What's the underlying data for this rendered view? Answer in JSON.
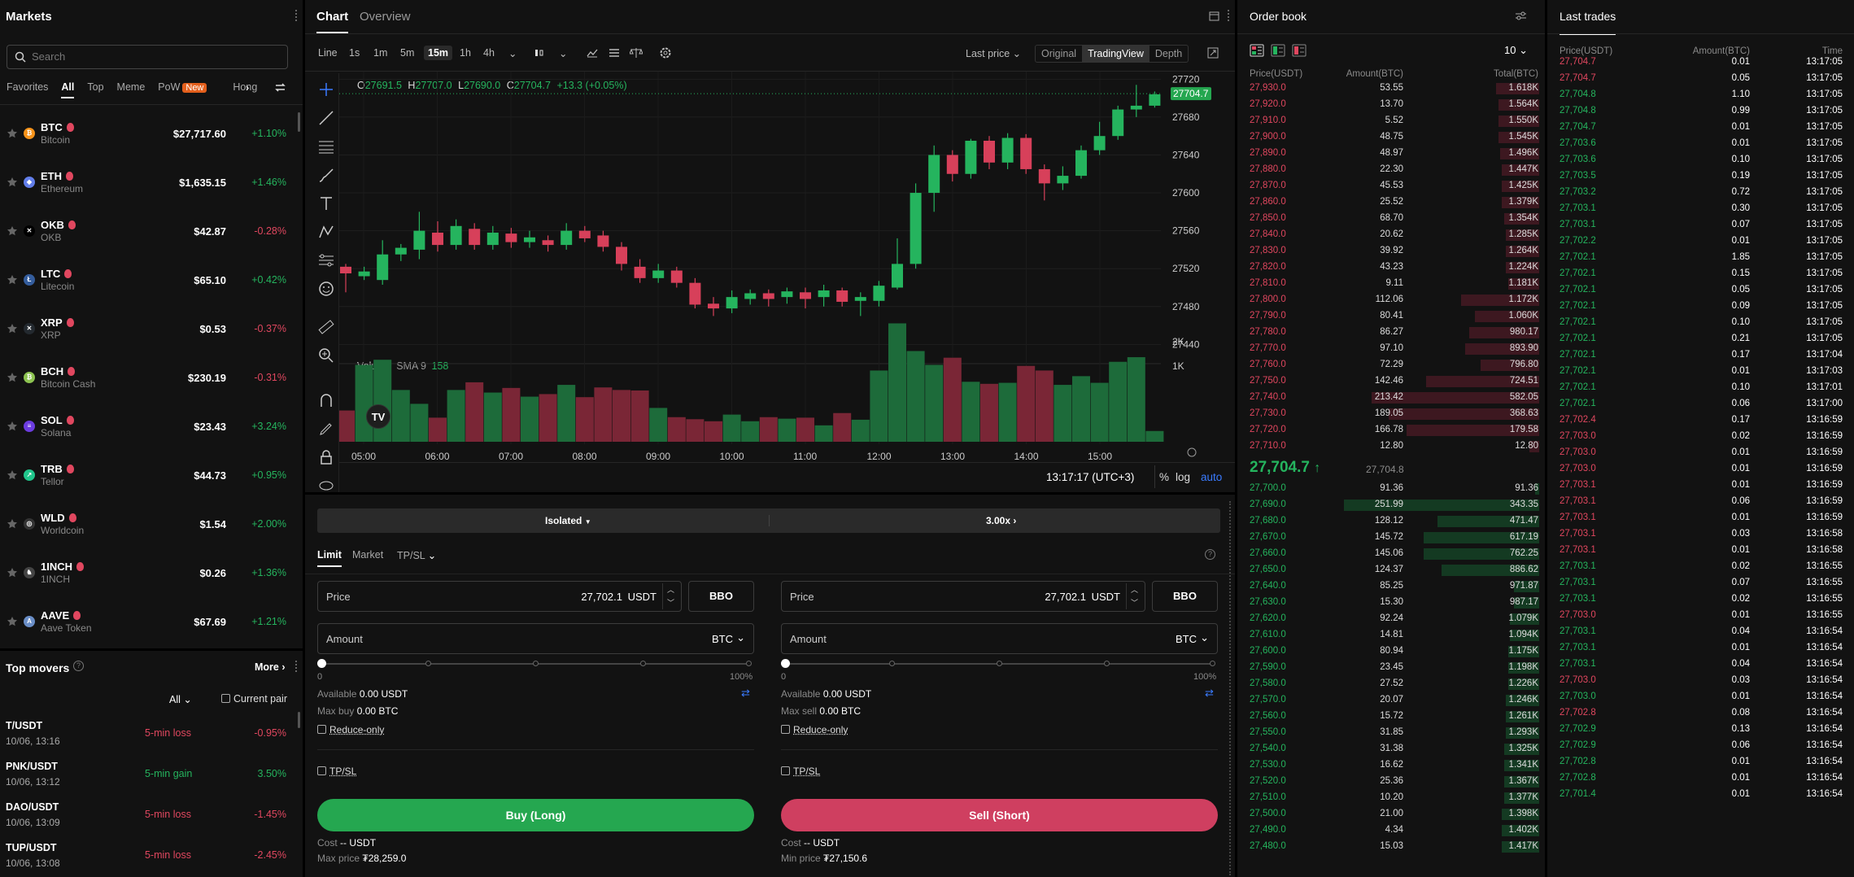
{
  "markets": {
    "title": "Markets",
    "search_placeholder": "Search",
    "tabs": [
      "Favorites",
      "All",
      "Top",
      "Meme",
      "PoW",
      "Hong"
    ],
    "new_badge": "New",
    "coins": [
      {
        "sym": "BTC",
        "name": "Bitcoin",
        "price": "$27,717.60",
        "change": "+1.10%",
        "up": true,
        "color": "#f7931a",
        "glyph": "₿"
      },
      {
        "sym": "ETH",
        "name": "Ethereum",
        "price": "$1,635.15",
        "change": "+1.46%",
        "up": true,
        "color": "#627eea",
        "glyph": "◆"
      },
      {
        "sym": "OKB",
        "name": "OKB",
        "price": "$42.87",
        "change": "-0.28%",
        "up": false,
        "color": "#000000",
        "glyph": "✕"
      },
      {
        "sym": "LTC",
        "name": "Litecoin",
        "price": "$65.10",
        "change": "+0.42%",
        "up": true,
        "color": "#345d9d",
        "glyph": "Ł"
      },
      {
        "sym": "XRP",
        "name": "XRP",
        "price": "$0.53",
        "change": "-0.37%",
        "up": false,
        "color": "#23292f",
        "glyph": "✕"
      },
      {
        "sym": "BCH",
        "name": "Bitcoin Cash",
        "price": "$230.19",
        "change": "-0.31%",
        "up": false,
        "color": "#8dc351",
        "glyph": "₿"
      },
      {
        "sym": "SOL",
        "name": "Solana",
        "price": "$23.43",
        "change": "+3.24%",
        "up": true,
        "color": "#6c3ce0",
        "glyph": "≡"
      },
      {
        "sym": "TRB",
        "name": "Tellor",
        "price": "$44.73",
        "change": "+0.95%",
        "up": true,
        "color": "#20c58b",
        "glyph": "↗"
      },
      {
        "sym": "WLD",
        "name": "Worldcoin",
        "price": "$1.54",
        "change": "+2.00%",
        "up": true,
        "color": "#333333",
        "glyph": "◎"
      },
      {
        "sym": "1INCH",
        "name": "1INCH",
        "price": "$0.26",
        "change": "+1.36%",
        "up": true,
        "color": "#444444",
        "glyph": "♞"
      },
      {
        "sym": "AAVE",
        "name": "Aave Token",
        "price": "$67.69",
        "change": "+1.21%",
        "up": true,
        "color": "#6a8ec7",
        "glyph": "A"
      }
    ]
  },
  "movers": {
    "title": "Top movers",
    "more": "More",
    "filter": "All",
    "current_pair": "Current pair",
    "items": [
      {
        "pair": "T/USDT",
        "date": "10/06, 13:16",
        "type": "5-min loss",
        "value": "-0.95%",
        "up": false
      },
      {
        "pair": "PNK/USDT",
        "date": "10/06, 13:12",
        "type": "5-min gain",
        "value": "3.50%",
        "up": true
      },
      {
        "pair": "DAO/USDT",
        "date": "10/06, 13:09",
        "type": "5-min loss",
        "value": "-1.45%",
        "up": false
      },
      {
        "pair": "TUP/USDT",
        "date": "10/06, 13:08",
        "type": "5-min loss",
        "value": "-2.45%",
        "up": false
      }
    ]
  },
  "chart": {
    "tabs": [
      "Chart",
      "Overview"
    ],
    "intervals": [
      "Line",
      "1s",
      "1m",
      "5m",
      "15m",
      "1h",
      "4h"
    ],
    "active_interval": "15m",
    "price_type": "Last price",
    "views": [
      "Original",
      "TradingView",
      "Depth"
    ],
    "active_view": "TradingView",
    "ohlc": {
      "o_label": "O",
      "o": "27691.5",
      "h_label": "H",
      "h": "27707.0",
      "l_label": "L",
      "l": "27690.0",
      "c_label": "C",
      "c": "27704.7",
      "chg": "+13.3 (+0.05%)"
    },
    "volume_label": "Volume",
    "sma_label": "SMA 9",
    "sma_value": "158",
    "time": "13:17:17 (UTC+3)",
    "pct": "%",
    "log": "log",
    "auto": "auto",
    "last_price_tag": "27704.7",
    "chart_data": {
      "type": "candlestick",
      "x_ticks": [
        "05:00",
        "06:00",
        "07:00",
        "08:00",
        "09:00",
        "10:00",
        "11:00",
        "12:00",
        "13:00",
        "14:00",
        "15:00"
      ],
      "y_ticks": [
        27720,
        27680,
        27640,
        27600,
        27560,
        27520,
        27480,
        27440
      ],
      "vol_ticks": [
        "2K",
        "1K"
      ],
      "ylim": [
        27430,
        27728
      ],
      "candles": [
        [
          27522,
          27515,
          27495,
          27525
        ],
        [
          27512,
          27517,
          27508,
          27522
        ],
        [
          27508,
          27535,
          27503,
          27550
        ],
        [
          27535,
          27542,
          27528,
          27546
        ],
        [
          27540,
          27560,
          27530,
          27580
        ],
        [
          27558,
          27545,
          27538,
          27570
        ],
        [
          27545,
          27565,
          27540,
          27572
        ],
        [
          27562,
          27545,
          27540,
          27568
        ],
        [
          27545,
          27558,
          27540,
          27565
        ],
        [
          27557,
          27548,
          27542,
          27563
        ],
        [
          27548,
          27553,
          27542,
          27560
        ],
        [
          27550,
          27545,
          27538,
          27555
        ],
        [
          27545,
          27560,
          27540,
          27568
        ],
        [
          27560,
          27552,
          27548,
          27565
        ],
        [
          27555,
          27543,
          27538,
          27560
        ],
        [
          27543,
          27525,
          27518,
          27548
        ],
        [
          27522,
          27510,
          27505,
          27530
        ],
        [
          27510,
          27518,
          27505,
          27525
        ],
        [
          27518,
          27505,
          27500,
          27522
        ],
        [
          27505,
          27482,
          27478,
          27510
        ],
        [
          27483,
          27478,
          27470,
          27490
        ],
        [
          27478,
          27490,
          27473,
          27497
        ],
        [
          27488,
          27494,
          27482,
          27498
        ],
        [
          27494,
          27488,
          27480,
          27498
        ],
        [
          27490,
          27496,
          27483,
          27500
        ],
        [
          27495,
          27488,
          27478,
          27500
        ],
        [
          27490,
          27497,
          27480,
          27503
        ],
        [
          27497,
          27485,
          27480,
          27500
        ],
        [
          27486,
          27490,
          27470,
          27495
        ],
        [
          27486,
          27502,
          27480,
          27507
        ],
        [
          27500,
          27525,
          27498,
          27552
        ],
        [
          27525,
          27600,
          27520,
          27610
        ],
        [
          27600,
          27640,
          27580,
          27650
        ],
        [
          27640,
          27620,
          27612,
          27645
        ],
        [
          27620,
          27655,
          27615,
          27657
        ],
        [
          27655,
          27632,
          27625,
          27660
        ],
        [
          27632,
          27658,
          27625,
          27663
        ],
        [
          27658,
          27625,
          27620,
          27662
        ],
        [
          27625,
          27610,
          27592,
          27630
        ],
        [
          27610,
          27618,
          27603,
          27628
        ],
        [
          27618,
          27645,
          27615,
          27650
        ],
        [
          27645,
          27660,
          27640,
          27675
        ],
        [
          27660,
          27688,
          27656,
          27692
        ],
        [
          27688,
          27692,
          27680,
          27714
        ],
        [
          27692,
          27704,
          27690,
          27707
        ]
      ],
      "volumes": [
        610,
        1500,
        1600,
        1010,
        740,
        470,
        1010,
        1160,
        960,
        1050,
        880,
        930,
        1110,
        870,
        1060,
        1010,
        1000,
        660,
        480,
        440,
        400,
        530,
        400,
        480,
        450,
        470,
        320,
        560,
        430,
        1390,
        2310,
        1770,
        1500,
        1640,
        1170,
        1130,
        1150,
        1480,
        1390,
        1110,
        1280,
        1150,
        1560,
        1650,
        210
      ]
    }
  },
  "trade": {
    "margin_mode": "Isolated",
    "leverage": "3.00x",
    "tabs": [
      "Limit",
      "Market",
      "TP/SL"
    ],
    "price_label": "Price",
    "amount_label": "Amount",
    "unit": "USDT",
    "coin": "BTC",
    "bbo": "BBO",
    "buy": {
      "price": "27,702.1",
      "available_label": "Available",
      "available": "0.00 USDT",
      "max_label": "Max buy",
      "max": "0.00 BTC",
      "btn": "Buy (Long)",
      "cost_label": "Cost",
      "cost": "-- USDT",
      "maxp_label": "Max price",
      "maxp": "₮28,259.0"
    },
    "sell": {
      "price": "27,702.1",
      "available_label": "Available",
      "available": "0.00 USDT",
      "max_label": "Max sell",
      "max": "0.00 BTC",
      "btn": "Sell (Short)",
      "cost_label": "Cost",
      "cost": "-- USDT",
      "maxp_label": "Min price",
      "maxp": "₮27,150.6"
    },
    "slider_min": "0",
    "slider_max": "100%",
    "reduce_only": "Reduce-only",
    "tpsl": "TP/SL"
  },
  "orderbook": {
    "title": "Order book",
    "depth": "10",
    "headers": [
      "Price(USDT)",
      "Amount(BTC)",
      "Total(BTC)"
    ],
    "mid_price": "27,704.7",
    "mid_index": "27,704.8",
    "asks": [
      [
        "27,930.0",
        "53.55",
        "1.618K",
        0.22
      ],
      [
        "27,920.0",
        "13.70",
        "1.564K",
        0.21
      ],
      [
        "27,910.0",
        "5.52",
        "1.550K",
        0.21
      ],
      [
        "27,900.0",
        "48.75",
        "1.545K",
        0.21
      ],
      [
        "27,890.0",
        "48.97",
        "1.496K",
        0.2
      ],
      [
        "27,880.0",
        "22.30",
        "1.447K",
        0.19
      ],
      [
        "27,870.0",
        "45.53",
        "1.425K",
        0.19
      ],
      [
        "27,860.0",
        "25.52",
        "1.379K",
        0.19
      ],
      [
        "27,850.0",
        "68.70",
        "1.354K",
        0.18
      ],
      [
        "27,840.0",
        "20.62",
        "1.285K",
        0.17
      ],
      [
        "27,830.0",
        "39.92",
        "1.264K",
        0.17
      ],
      [
        "27,820.0",
        "43.23",
        "1.224K",
        0.17
      ],
      [
        "27,810.0",
        "9.11",
        "1.181K",
        0.16
      ],
      [
        "27,800.0",
        "112.06",
        "1.172K",
        0.4
      ],
      [
        "27,790.0",
        "80.41",
        "1.060K",
        0.33
      ],
      [
        "27,780.0",
        "86.27",
        "980.17",
        0.36
      ],
      [
        "27,770.0",
        "97.10",
        "893.90",
        0.38
      ],
      [
        "27,760.0",
        "72.29",
        "796.80",
        0.3
      ],
      [
        "27,750.0",
        "142.46",
        "724.51",
        0.58
      ],
      [
        "27,740.0",
        "213.42",
        "582.05",
        0.86
      ],
      [
        "27,730.0",
        "189.05",
        "368.63",
        0.77
      ],
      [
        "27,720.0",
        "166.78",
        "179.58",
        0.68
      ],
      [
        "27,710.0",
        "12.80",
        "12.80",
        0.05
      ]
    ],
    "bids": [
      [
        "27,700.0",
        "91.36",
        "91.36",
        0.02
      ],
      [
        "27,690.0",
        "251.99",
        "343.35",
        1.0
      ],
      [
        "27,680.0",
        "128.12",
        "471.47",
        0.52
      ],
      [
        "27,670.0",
        "145.72",
        "617.19",
        0.59
      ],
      [
        "27,660.0",
        "145.06",
        "762.25",
        0.59
      ],
      [
        "27,650.0",
        "124.37",
        "886.62",
        0.5
      ],
      [
        "27,640.0",
        "85.25",
        "971.87",
        0.13
      ],
      [
        "27,630.0",
        "15.30",
        "987.17",
        0.13
      ],
      [
        "27,620.0",
        "92.24",
        "1.079K",
        0.15
      ],
      [
        "27,610.0",
        "14.81",
        "1.094K",
        0.15
      ],
      [
        "27,600.0",
        "80.94",
        "1.175K",
        0.16
      ],
      [
        "27,590.0",
        "23.45",
        "1.198K",
        0.16
      ],
      [
        "27,580.0",
        "27.52",
        "1.226K",
        0.16
      ],
      [
        "27,570.0",
        "20.07",
        "1.246K",
        0.17
      ],
      [
        "27,560.0",
        "15.72",
        "1.261K",
        0.17
      ],
      [
        "27,550.0",
        "31.85",
        "1.293K",
        0.17
      ],
      [
        "27,540.0",
        "31.38",
        "1.325K",
        0.18
      ],
      [
        "27,530.0",
        "16.62",
        "1.341K",
        0.18
      ],
      [
        "27,520.0",
        "25.36",
        "1.367K",
        0.18
      ],
      [
        "27,510.0",
        "10.20",
        "1.377K",
        0.18
      ],
      [
        "27,500.0",
        "21.00",
        "1.398K",
        0.19
      ],
      [
        "27,490.0",
        "4.34",
        "1.402K",
        0.19
      ],
      [
        "27,480.0",
        "15.03",
        "1.417K",
        0.19
      ]
    ]
  },
  "lasttrades": {
    "title": "Last trades",
    "headers": [
      "Price(USDT)",
      "Amount(BTC)",
      "Time"
    ],
    "rows": [
      [
        "27,704.7",
        "0.01",
        "13:17:05",
        0
      ],
      [
        "27,704.7",
        "0.05",
        "13:17:05",
        0
      ],
      [
        "27,704.8",
        "1.10",
        "13:17:05",
        1
      ],
      [
        "27,704.8",
        "0.99",
        "13:17:05",
        1
      ],
      [
        "27,704.7",
        "0.01",
        "13:17:05",
        1
      ],
      [
        "27,703.6",
        "0.01",
        "13:17:05",
        1
      ],
      [
        "27,703.6",
        "0.10",
        "13:17:05",
        1
      ],
      [
        "27,703.5",
        "0.19",
        "13:17:05",
        1
      ],
      [
        "27,703.2",
        "0.72",
        "13:17:05",
        1
      ],
      [
        "27,703.1",
        "0.30",
        "13:17:05",
        1
      ],
      [
        "27,703.1",
        "0.07",
        "13:17:05",
        1
      ],
      [
        "27,702.2",
        "0.01",
        "13:17:05",
        1
      ],
      [
        "27,702.1",
        "1.85",
        "13:17:05",
        1
      ],
      [
        "27,702.1",
        "0.15",
        "13:17:05",
        1
      ],
      [
        "27,702.1",
        "0.05",
        "13:17:05",
        1
      ],
      [
        "27,702.1",
        "0.09",
        "13:17:05",
        1
      ],
      [
        "27,702.1",
        "0.10",
        "13:17:05",
        1
      ],
      [
        "27,702.1",
        "0.21",
        "13:17:05",
        1
      ],
      [
        "27,702.1",
        "0.17",
        "13:17:04",
        1
      ],
      [
        "27,702.1",
        "0.01",
        "13:17:03",
        1
      ],
      [
        "27,702.1",
        "0.10",
        "13:17:01",
        1
      ],
      [
        "27,702.1",
        "0.06",
        "13:17:00",
        1
      ],
      [
        "27,702.4",
        "0.17",
        "13:16:59",
        0
      ],
      [
        "27,703.0",
        "0.02",
        "13:16:59",
        0
      ],
      [
        "27,703.0",
        "0.01",
        "13:16:59",
        0
      ],
      [
        "27,703.0",
        "0.01",
        "13:16:59",
        0
      ],
      [
        "27,703.1",
        "0.01",
        "13:16:59",
        0
      ],
      [
        "27,703.1",
        "0.06",
        "13:16:59",
        0
      ],
      [
        "27,703.1",
        "0.01",
        "13:16:59",
        0
      ],
      [
        "27,703.1",
        "0.03",
        "13:16:58",
        0
      ],
      [
        "27,703.1",
        "0.01",
        "13:16:58",
        0
      ],
      [
        "27,703.1",
        "0.02",
        "13:16:55",
        1
      ],
      [
        "27,703.1",
        "0.07",
        "13:16:55",
        1
      ],
      [
        "27,703.1",
        "0.02",
        "13:16:55",
        1
      ],
      [
        "27,703.0",
        "0.01",
        "13:16:55",
        0
      ],
      [
        "27,703.1",
        "0.04",
        "13:16:54",
        1
      ],
      [
        "27,703.1",
        "0.01",
        "13:16:54",
        1
      ],
      [
        "27,703.1",
        "0.04",
        "13:16:54",
        1
      ],
      [
        "27,703.0",
        "0.03",
        "13:16:54",
        0
      ],
      [
        "27,703.0",
        "0.01",
        "13:16:54",
        1
      ],
      [
        "27,702.8",
        "0.08",
        "13:16:54",
        0
      ],
      [
        "27,702.9",
        "0.13",
        "13:16:54",
        1
      ],
      [
        "27,702.9",
        "0.06",
        "13:16:54",
        1
      ],
      [
        "27,702.8",
        "0.01",
        "13:16:54",
        1
      ],
      [
        "27,702.8",
        "0.01",
        "13:16:54",
        1
      ],
      [
        "27,701.4",
        "0.01",
        "13:16:54",
        1
      ]
    ]
  }
}
